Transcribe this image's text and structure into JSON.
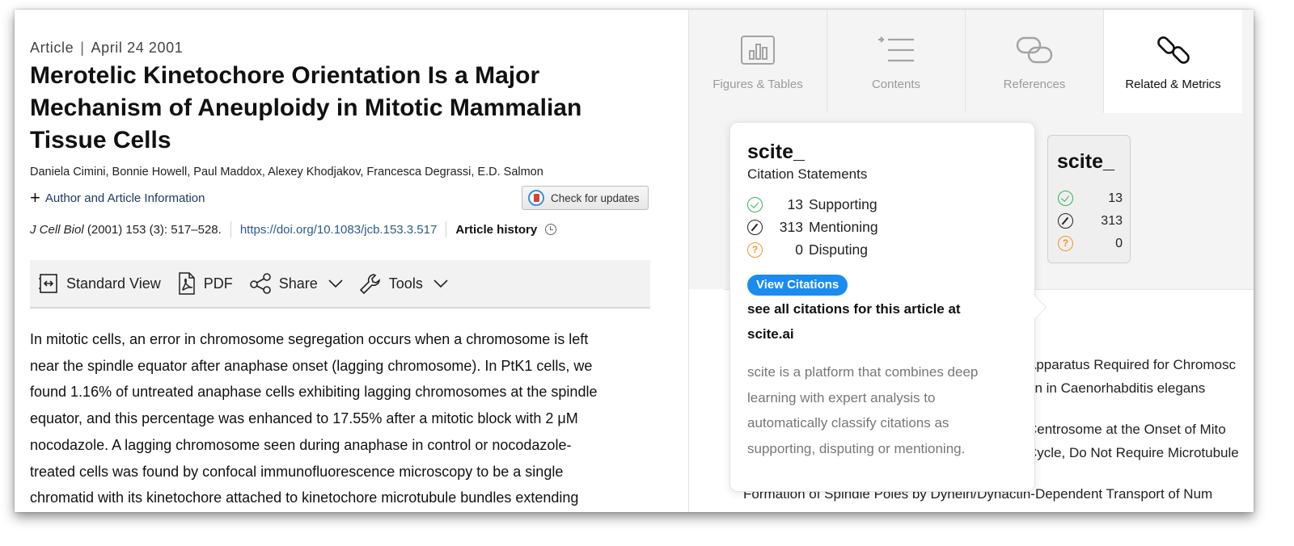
{
  "article": {
    "type": "Article",
    "separator": "|",
    "date": "April 24 2001",
    "title": "Merotelic Kinetochore Orientation Is a Major Mechanism of Aneuploidy in Mitotic Mammalian Tissue Cells",
    "authors": "Daniela Cimini, Bonnie Howell, Paul Maddox, Alexey Khodjakov, Francesca Degrassi, E.D. Salmon",
    "author_info_label": "Author and Article Information",
    "check_updates_label": "Check for updates",
    "journal": "J Cell Biol",
    "citation_rest": "(2001) 153 (3): 517–528.",
    "doi": "https://doi.org/10.1083/jcb.153.3.517",
    "history_label": "Article history"
  },
  "toolbar": {
    "standard_view": "Standard View",
    "pdf": "PDF",
    "share": "Share",
    "tools": "Tools"
  },
  "abstract_lines": [
    "In mitotic cells, an error in chromosome segregation occurs when a chromosome is left",
    "near the spindle equator after anaphase onset (lagging chromosome). In PtK1 cells, we",
    "found 1.16% of untreated anaphase cells exhibiting lagging chromosomes at the spindle",
    "equator, and this percentage was enhanced to 17.55% after a mitotic block with 2 μM",
    "nocodazole. A lagging chromosome seen during anaphase in control or nocodazole-",
    "treated cells was found by confocal immunofluorescence microscopy to be a single",
    "chromatid with its kinetochore attached to kinetochore microtubule bundles extending"
  ],
  "tabs": [
    {
      "label": "Figures & Tables",
      "icon": "bar-chart-icon"
    },
    {
      "label": "Contents",
      "icon": "contents-list-icon"
    },
    {
      "label": "References",
      "icon": "references-link-icon"
    },
    {
      "label": "Related & Metrics",
      "icon": "chain-link-icon"
    }
  ],
  "scite_popup": {
    "logo": "scite_",
    "subtitle": "Citation Statements",
    "supporting_count": "13",
    "supporting_label": "Supporting",
    "mentioning_count": "313",
    "mentioning_label": "Mentioning",
    "disputing_count": "0",
    "disputing_label": "Disputing",
    "view_button": "View Citations",
    "see_all_line1": "see all citations for this article at",
    "see_all_line2": "scite.ai",
    "description_lines": [
      "scite is a platform that combines deep",
      "learning with expert analysis to",
      "automatically classify citations as",
      "supporting, disputing or mentioning."
    ]
  },
  "scite_badge": {
    "logo": "scite_",
    "supporting": "13",
    "mentioning": "313",
    "disputing": "0"
  },
  "related_partial": [
    "Apparatus Required for Chromosc",
    "on in Caenorhabditis elegans",
    "Centrosome at the Onset of Mito",
    "Cycle, Do Not Require Microtubule",
    "Formation of Spindle Poles by Dynein/Dynactin-Dependent Transport of Num"
  ],
  "colors": {
    "supporting": "#2fb45a",
    "disputing": "#f0952a",
    "scite_button": "#1a8cf0",
    "doi_link": "#2d5a8c"
  }
}
